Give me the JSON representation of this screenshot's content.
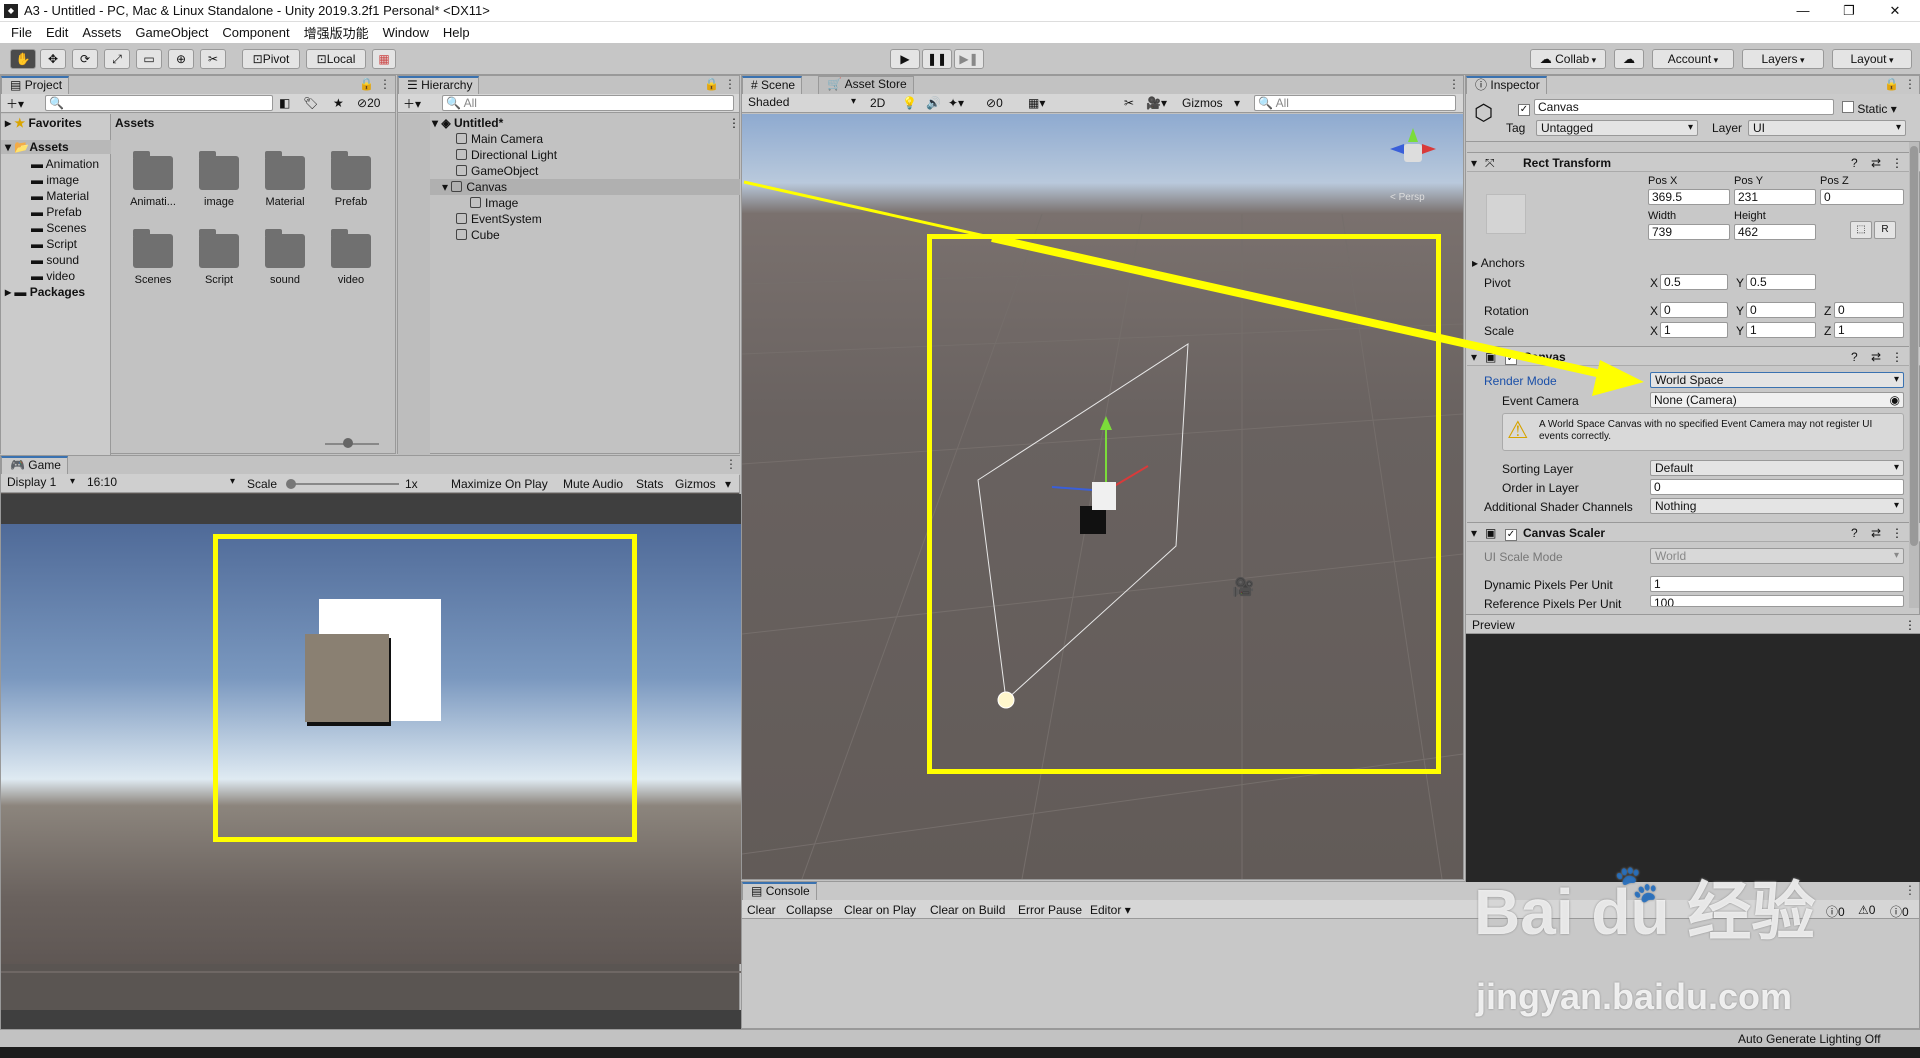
{
  "window": {
    "title": "A3 - Untitled - PC, Mac & Linux Standalone - Unity 2019.3.2f1 Personal* <DX11>"
  },
  "menu": [
    "File",
    "Edit",
    "Assets",
    "GameObject",
    "Component",
    "增强版功能",
    "Window",
    "Help"
  ],
  "toolbar": {
    "pivot": "Pivot",
    "local": "Local",
    "collab": "Collab",
    "account": "Account",
    "layers": "Layers",
    "layout": "Layout"
  },
  "project": {
    "tab": "Project",
    "count": "20",
    "favorites": "Favorites",
    "assets_root": "Assets",
    "assets_header": "Assets",
    "tree": [
      "Animation",
      "image",
      "Material",
      "Prefab",
      "Scenes",
      "Script",
      "sound",
      "video"
    ],
    "packages": "Packages",
    "folders": [
      "Animati...",
      "image",
      "Material",
      "Prefab",
      "Scenes",
      "Script",
      "sound",
      "video"
    ]
  },
  "hierarchy": {
    "tab": "Hierarchy",
    "search_placeholder": "All",
    "scene": "Untitled*",
    "items": [
      "Main Camera",
      "Directional Light",
      "GameObject",
      "Canvas",
      "Image",
      "EventSystem",
      "Cube"
    ]
  },
  "scene": {
    "tab": "Scene",
    "asset_store_tab": "Asset Store",
    "shading": "Shaded",
    "mode_2d": "2D",
    "hidden_count": "0",
    "gizmos": "Gizmos",
    "search_placeholder": "All",
    "persp": "< Persp"
  },
  "game": {
    "tab": "Game",
    "display": "Display 1",
    "aspect": "16:10",
    "scale_label": "Scale",
    "scale_value": "1x",
    "maximize": "Maximize On Play",
    "mute": "Mute Audio",
    "stats": "Stats",
    "gizmos": "Gizmos"
  },
  "console": {
    "tab": "Console",
    "buttons": [
      "Clear",
      "Collapse",
      "Clear on Play",
      "Clear on Build",
      "Error Pause",
      "Editor"
    ],
    "counts": [
      "0",
      "0",
      "0"
    ]
  },
  "inspector": {
    "tab": "Inspector",
    "object_name": "Canvas",
    "static": "Static",
    "tag_label": "Tag",
    "tag": "Untagged",
    "layer_label": "Layer",
    "layer": "UI",
    "rect_transform": {
      "title": "Rect Transform",
      "pos_x_label": "Pos X",
      "pos_y_label": "Pos Y",
      "pos_z_label": "Pos Z",
      "pos_x": "369.5",
      "pos_y": "231",
      "pos_z": "0",
      "width_label": "Width",
      "height_label": "Height",
      "width": "739",
      "height": "462",
      "anchors": "Anchors",
      "pivot": "Pivot",
      "pivot_x": "0.5",
      "pivot_y": "0.5",
      "rotation": "Rotation",
      "rot_x": "0",
      "rot_y": "0",
      "rot_z": "0",
      "scale": "Scale",
      "scale_x": "1",
      "scale_y": "1",
      "scale_z": "1",
      "x": "X",
      "y": "Y",
      "z": "Z",
      "r": "R"
    },
    "canvas": {
      "title": "Canvas",
      "render_mode_label": "Render Mode",
      "render_mode": "World Space",
      "event_camera_label": "Event Camera",
      "event_camera": "None (Camera)",
      "warning": "A World Space Canvas with no specified Event Camera may not register UI events correctly.",
      "sorting_layer_label": "Sorting Layer",
      "sorting_layer": "Default",
      "order_label": "Order in Layer",
      "order": "0",
      "shader_label": "Additional Shader Channels",
      "shader": "Nothing"
    },
    "canvas_scaler": {
      "title": "Canvas Scaler",
      "ui_scale_label": "UI Scale Mode",
      "ui_scale": "World",
      "dpu_label": "Dynamic Pixels Per Unit",
      "dpu": "1",
      "ref_label": "Reference Pixels Per Unit",
      "ref": "100"
    },
    "preview": "Preview"
  },
  "status": {
    "text": "Auto Generate Lighting Off"
  },
  "watermark": {
    "brand": "Bai du 经验",
    "url": "jingyan.baidu.com"
  },
  "colors": {
    "highlight": "#ffff00",
    "tab_accent": "#3a72b0",
    "blue_label": "#1a4fa8"
  }
}
